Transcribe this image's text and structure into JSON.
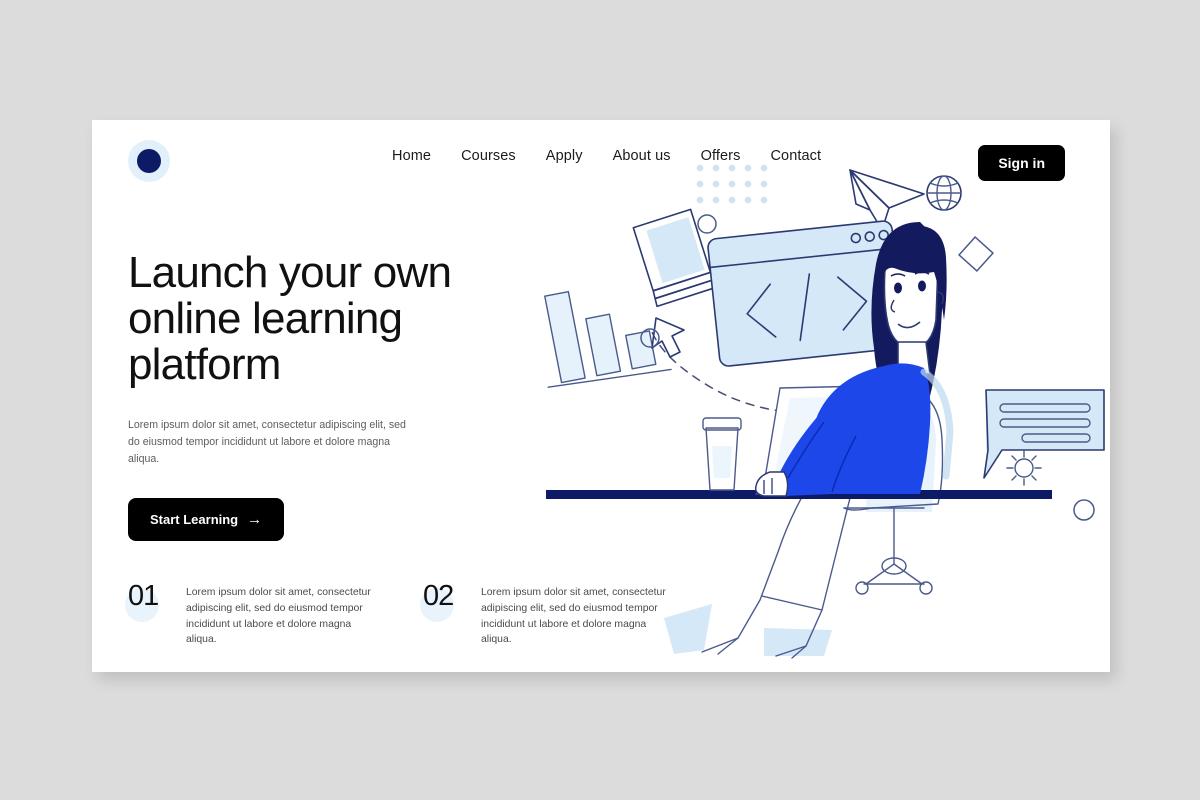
{
  "brand": {
    "logo_icon": "circle-dot-logo",
    "primary_navy": "#0d1b66",
    "accent_blue": "#1d47e8",
    "light_blue": "#d6e9f7",
    "page_bg": "#dcdcdc",
    "card_bg": "#ffffff"
  },
  "nav": {
    "items": [
      {
        "label": "Home"
      },
      {
        "label": "Courses"
      },
      {
        "label": "Apply"
      },
      {
        "label": "About us"
      },
      {
        "label": "Offers"
      },
      {
        "label": "Contact"
      }
    ],
    "signin_label": "Sign in"
  },
  "hero": {
    "headline_line1": "Launch your own",
    "headline_line2": "online learning",
    "headline_line3": "platform",
    "subtext": "Lorem ipsum dolor sit amet, consectetur adipiscing elit, sed do eiusmod tempor incididunt ut labore et dolore magna aliqua.",
    "cta_label": "Start Learning",
    "cta_arrow": "→"
  },
  "features": [
    {
      "number": "01",
      "text": "Lorem ipsum dolor sit amet, consectetur adipiscing elit, sed do eiusmod tempor incididunt ut labore et dolore magna aliqua."
    },
    {
      "number": "02",
      "text": "Lorem ipsum dolor sit amet, consectetur adipiscing elit, sed do eiusmod tempor incididunt ut labore et dolore magna aliqua."
    }
  ],
  "illustration": {
    "description": "Woman working on laptop at desk with floating learning icons",
    "elements": [
      "books-stack-icon",
      "bar-chart-icon",
      "code-window-icon",
      "paper-plane-icon",
      "globe-icon",
      "chat-bubble-icon",
      "gear-icon",
      "cursor-arrow-icon",
      "dot-grid-icon",
      "diamond-icon",
      "circle-outline-icon",
      "laptop-icon",
      "coffee-cup-icon",
      "office-chair-icon",
      "person-figure"
    ],
    "code_symbol": "</>"
  }
}
